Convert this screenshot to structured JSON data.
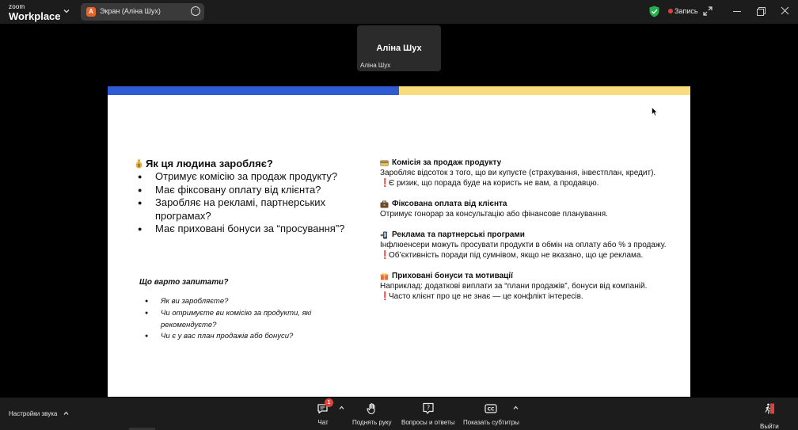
{
  "app": {
    "logo_small": "zoom",
    "logo_big": "Workplace"
  },
  "share": {
    "badge": "A",
    "title": "Экран (Аліна Шух)"
  },
  "recording": {
    "label": "Запись",
    "color": "#e2403a"
  },
  "participant": {
    "name": "Аліна Шух",
    "label": "Аліна Шух"
  },
  "slide": {
    "flag_colors": [
      "#2f5bd4",
      "#f9dc7b"
    ],
    "left": {
      "heading_icon": "money-bag-icon",
      "heading": "Як ця людина заробляє?",
      "items": [
        "Отримує комісію за продаж продукту?",
        "Має фіксовану оплату від клієнта?",
        "Заробляє на рекламі, партнерських програмах?",
        "Має приховані бонуси за “просування”?"
      ],
      "ask_title": "Що варто запитати?",
      "ask_items": [
        "Як ви заробляєте?",
        "Чи отримуєте ви комісію за продукти, які рекомендуєте?",
        "Чи є у вас план продажів або бонуси?"
      ]
    },
    "right": {
      "sections": [
        {
          "icon": "credit-card-icon",
          "title": "Комісія за продаж продукту",
          "text": "Заробляє відсоток з того, що ви купуєте (страхування, інвестплан, кредит).",
          "warning": "Є ризик, що порада буде на користь не вам, а продавцю."
        },
        {
          "icon": "briefcase-icon",
          "title": "Фіксована оплата від клієнта",
          "text": "Отримує гонорар за консультацію або фінансове планування."
        },
        {
          "icon": "phone-ad-icon",
          "title": "Реклама та партнерські програми",
          "text": "Інфлюенсери можуть просувати продукти в обмін на оплату або % з продажу.",
          "warning": "Об’єктивність поради під сумнівом, якщо не вказано, що це реклама."
        },
        {
          "icon": "gift-icon",
          "title": "Приховані бонуси та мотивації",
          "text": "Наприклад: додаткові виплати за “плани продажів”, бонуси від компаній.",
          "warning": "Часто клієнт про це не знає — це конфлікт інтересів."
        }
      ],
      "warning_mark": "❗"
    }
  },
  "toolbar": {
    "audio_settings": "Настройки звука",
    "chat_label": "Чат",
    "chat_badge": "1",
    "raise_hand_label": "Поднять руку",
    "qa_label": "Вопросы и ответы",
    "captions_label": "Показать субтитры",
    "leave_label": "Выйти"
  }
}
